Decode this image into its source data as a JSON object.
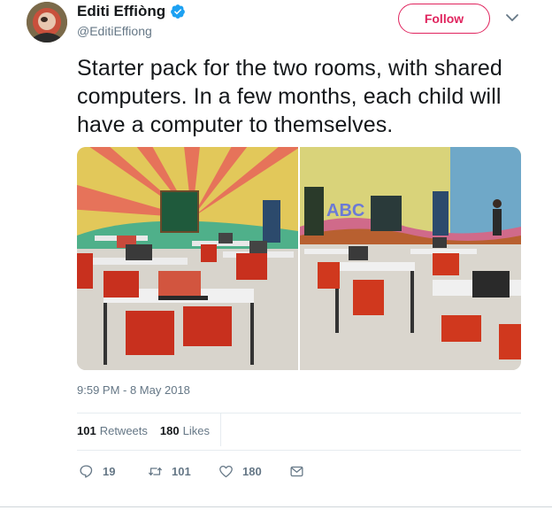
{
  "author": {
    "name": "Editi Effiòng",
    "handle": "@EditiEffiong",
    "verified": true
  },
  "follow_button": {
    "label": "Follow",
    "color": "#e0245e"
  },
  "tweet_text": "Starter pack for the two rooms, with shared computers. In a few months, each child will have a computer to themselves.",
  "photo_wall_lettering": "ABC",
  "timestamp": "9:59 PM - 8 May 2018",
  "stats": {
    "retweets_count": "101",
    "retweets_label": "Retweets",
    "likes_count": "180",
    "likes_label": "Likes"
  },
  "actions": {
    "reply_count": "19",
    "retweet_count": "101",
    "like_count": "180"
  },
  "icons": [
    "verified-badge-icon",
    "chevron-down-icon",
    "reply-icon",
    "retweet-icon",
    "like-icon",
    "direct-message-icon"
  ],
  "colors": {
    "accent": "#e0245e",
    "verified": "#1da1f2",
    "secondary_text": "#657786"
  }
}
